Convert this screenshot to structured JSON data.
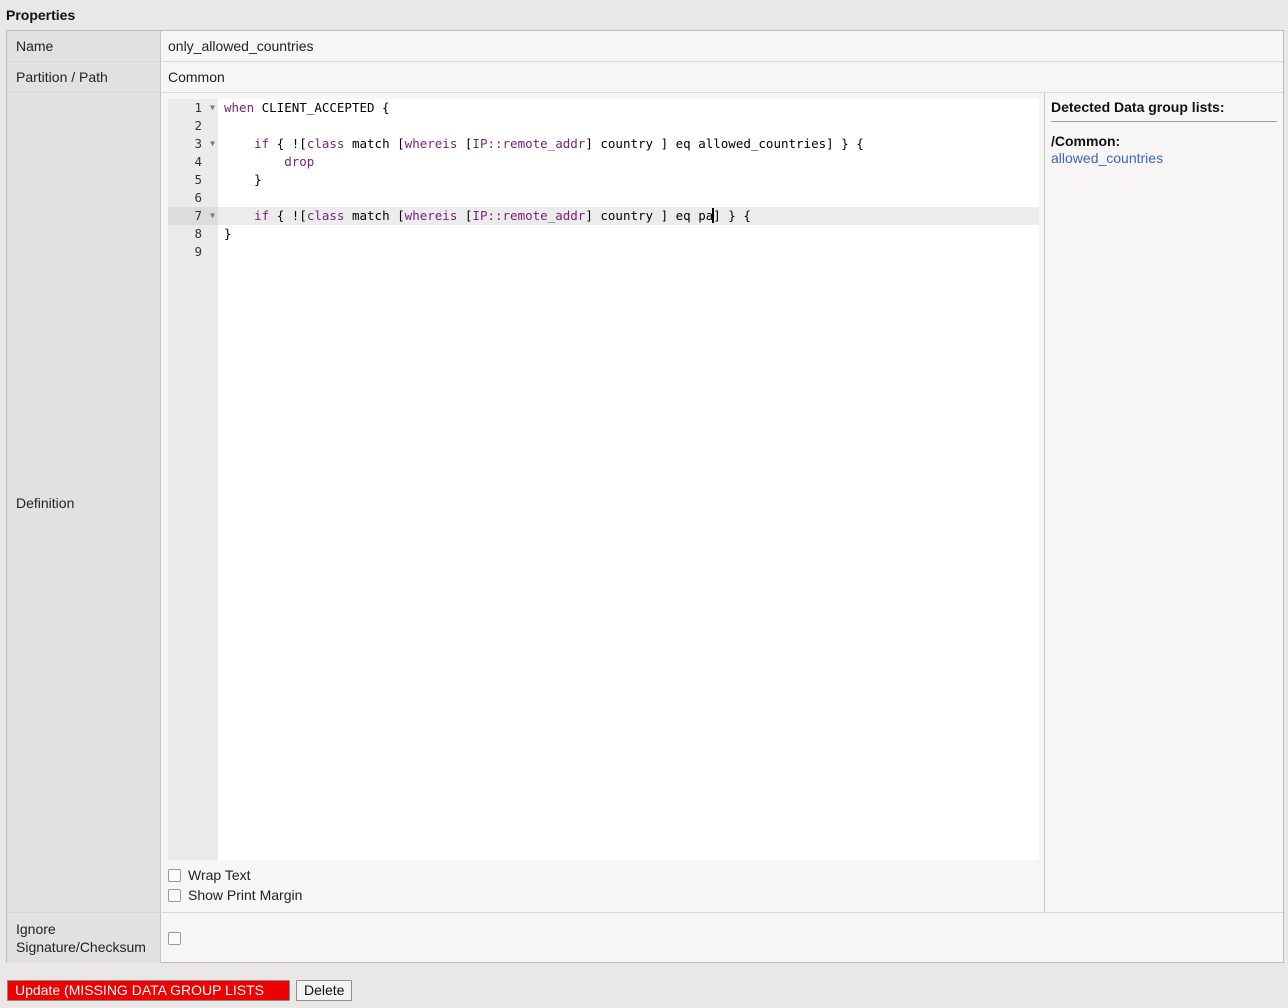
{
  "section": {
    "title": "Properties"
  },
  "fields": {
    "name": {
      "label": "Name",
      "value": "only_allowed_countries"
    },
    "path": {
      "label": "Partition / Path",
      "value": "Common"
    },
    "definition": {
      "label": "Definition"
    },
    "ignore": {
      "label_line1": "Ignore",
      "label_line2": "Signature/Checksum",
      "checked": false
    }
  },
  "editor": {
    "active_line": 7,
    "line_numbers": [
      "1",
      "2",
      "3",
      "4",
      "5",
      "6",
      "7",
      "8",
      "9"
    ],
    "fold_markers_on_lines": [
      1,
      3,
      7
    ],
    "lines": [
      "when CLIENT_ACCEPTED {",
      "",
      "    if { ![class match [whereis [IP::remote_addr] country ] eq allowed_countries] } {",
      "        drop",
      "    }",
      "",
      "    if { ![class match [whereis [IP::remote_addr] country ] eq pa] } {",
      "}",
      ""
    ]
  },
  "options": {
    "wrap_text": {
      "label": "Wrap Text",
      "checked": false
    },
    "print_margin": {
      "label": "Show Print Margin",
      "checked": false
    }
  },
  "detected": {
    "title": "Detected Data group lists:",
    "partition": "/Common:",
    "links": [
      "allowed_countries"
    ]
  },
  "buttons": {
    "update_label": "Update (MISSING DATA GROUP LISTS",
    "delete_label": "Delete"
  },
  "colors": {
    "update_button_bg": "#ee0000",
    "link": "#3b66c4",
    "keyword": "#7a1f7a"
  }
}
